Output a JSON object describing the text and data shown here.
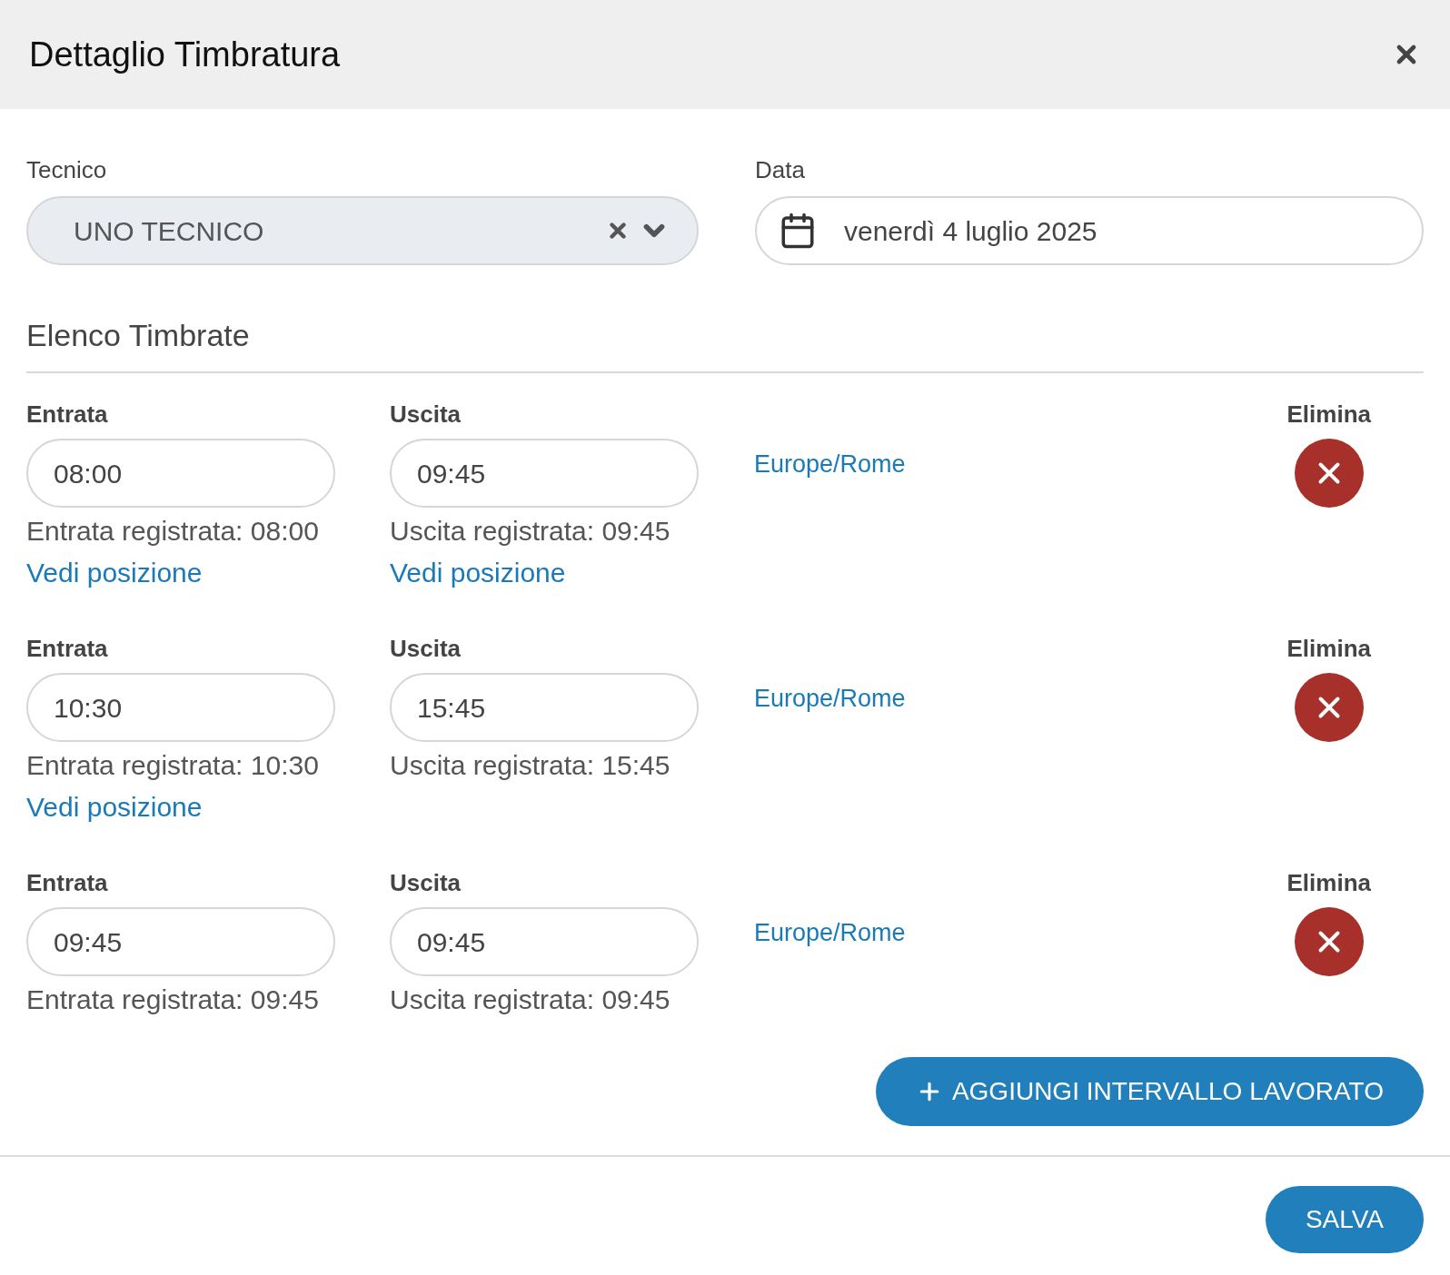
{
  "header": {
    "title": "Dettaglio Timbratura"
  },
  "tecnico": {
    "label": "Tecnico",
    "value": "UNO TECNICO",
    "disabled": true
  },
  "data": {
    "label": "Data",
    "value": "venerdì 4 luglio 2025"
  },
  "section_title": "Elenco Timbrate",
  "entries": [
    {
      "entrata_label": "Entrata",
      "entrata": "08:00",
      "entrata_registrata": "Entrata registrata: 08:00",
      "entrata_link": "Vedi posizione",
      "uscita_label": "Uscita",
      "uscita": "09:45",
      "uscita_registrata": "Uscita registrata: 09:45",
      "uscita_link": "Vedi posizione",
      "timezone": "Europe/Rome",
      "elimina_label": "Elimina"
    },
    {
      "entrata_label": "Entrata",
      "entrata": "10:30",
      "entrata_registrata": "Entrata registrata: 10:30",
      "entrata_link": "Vedi posizione",
      "uscita_label": "Uscita",
      "uscita": "15:45",
      "uscita_registrata": "Uscita registrata: 15:45",
      "timezone": "Europe/Rome",
      "elimina_label": "Elimina"
    },
    {
      "entrata_label": "Entrata",
      "entrata": "09:45",
      "entrata_registrata": "Entrata registrata: 09:45",
      "uscita_label": "Uscita",
      "uscita": "09:45",
      "uscita_registrata": "Uscita registrata: 09:45",
      "timezone": "Europe/Rome",
      "elimina_label": "Elimina"
    }
  ],
  "add_button": "AGGIUNGI INTERVALLO LAVORATO",
  "save_button": "SALVA"
}
